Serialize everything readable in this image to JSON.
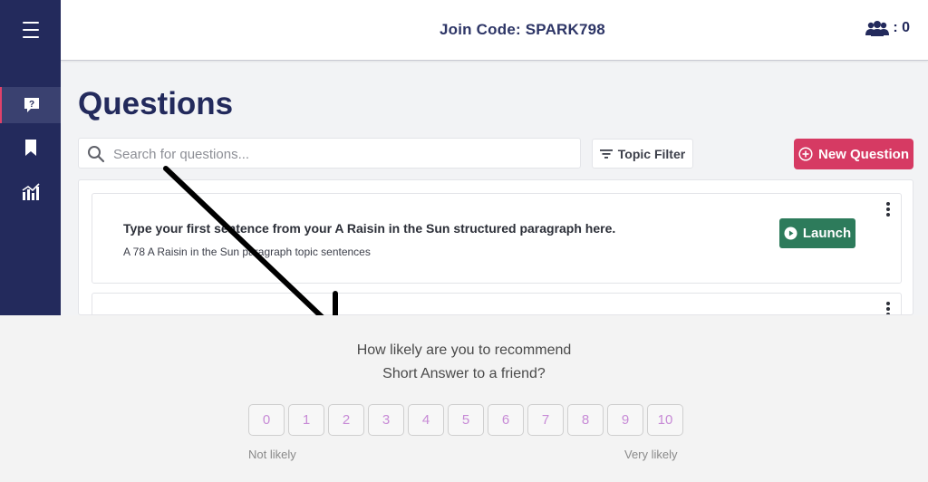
{
  "header": {
    "join_code": "Join Code: SPARK798",
    "participants_count": "0"
  },
  "sidebar": {
    "items": [
      {
        "name": "menu",
        "icon": "hamburger-icon"
      },
      {
        "name": "questions",
        "icon": "question-bubble-icon",
        "active": true
      },
      {
        "name": "saved",
        "icon": "bookmark-icon"
      },
      {
        "name": "reports",
        "icon": "bar-chart-icon"
      }
    ]
  },
  "main": {
    "title": "Questions",
    "search_placeholder": "Search for questions...",
    "topic_filter_label": "Topic Filter",
    "new_question_label": "New Question",
    "questions": [
      {
        "text": "Type your first sentence from your A Raisin in the Sun structured paragraph here.",
        "topic": "A 78 A Raisin in the Sun paragraph topic sentences",
        "launch_label": "Launch"
      }
    ]
  },
  "survey": {
    "question_line1": "How likely are you to recommend",
    "question_line2": "Short Answer to a friend?",
    "options": [
      "0",
      "1",
      "2",
      "3",
      "4",
      "5",
      "6",
      "7",
      "8",
      "9",
      "10"
    ],
    "low_label": "Not likely",
    "high_label": "Very likely"
  },
  "colors": {
    "sidebar_bg": "#232a5c",
    "brand_navy": "#232a5c",
    "new_question_bg": "#d63a63",
    "launch_bg": "#2d7b5b",
    "scale_text": "#c78ad6"
  }
}
